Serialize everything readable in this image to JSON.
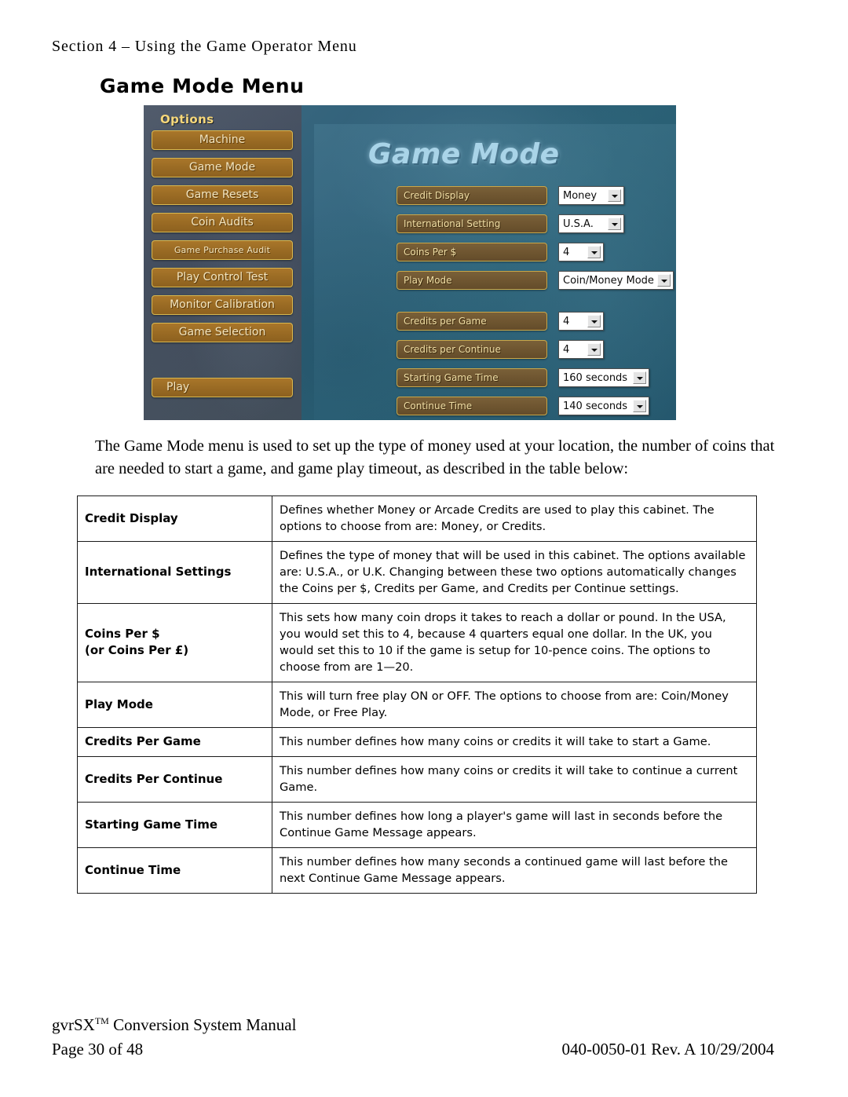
{
  "running_head": "Section 4  –  Using the Game Operator Menu",
  "page_title": "Game Mode Menu",
  "screenshot": {
    "heading": "Game Mode",
    "nav": {
      "title": "Options",
      "items": [
        "Machine",
        "Game Mode",
        "Game Resets",
        "Coin Audits",
        "Game Purchase Audit",
        "Play Control Test",
        "Monitor Calibration",
        "Game Selection"
      ],
      "play_label": "Play"
    },
    "settings": [
      {
        "label": "Credit Display",
        "value": "Money"
      },
      {
        "label": "International Setting",
        "value": "U.S.A."
      },
      {
        "label": "Coins Per $",
        "value": "4"
      },
      {
        "label": "Play Mode",
        "value": "Coin/Money Mode"
      },
      {
        "label": "Credits per Game",
        "value": "4"
      },
      {
        "label": "Credits per Continue",
        "value": "4"
      },
      {
        "label": "Starting Game Time",
        "value": "160 seconds"
      },
      {
        "label": "Continue Time",
        "value": "140 seconds"
      }
    ]
  },
  "intro_paragraph": "The Game Mode menu is used to set up the type of money used at your location, the number of coins that are needed to start a game, and game play timeout, as described in the table below:",
  "table": {
    "rows": [
      {
        "term": "Credit Display",
        "description": "Defines whether Money or Arcade Credits are used to play this cabinet. The options to choose from are: Money, or Credits."
      },
      {
        "term": "International Settings",
        "description": "Defines the type of money that will be used in this cabinet.  The options available are: U.S.A., or U.K.  Changing between these two options automatically changes the Coins per $, Credits per Game, and Credits per Continue settings."
      },
      {
        "term": "Coins Per $\n(or Coins Per £)",
        "description": "This sets how many coin drops it takes to reach a dollar or pound. In the USA, you would set this to 4, because 4 quarters equal one dollar. In the UK, you would set this to 10 if the game is setup for 10-pence coins. The options to choose from are 1—20."
      },
      {
        "term": "Play Mode",
        "description": "This will turn free play ON or OFF. The options to choose from are: Coin/Money Mode, or Free Play."
      },
      {
        "term": "Credits Per Game",
        "description": "This number defines how many coins or credits it will take to start a Game."
      },
      {
        "term": "Credits Per Continue",
        "description": "This number defines how many coins or credits it will take to continue a current Game."
      },
      {
        "term": "Starting Game Time",
        "description": "This number defines how long a player's game will last in seconds before the Continue Game Message appears."
      },
      {
        "term": "Continue Time",
        "description": "This number defines how many seconds a continued game will last before the next Continue Game Message appears."
      }
    ]
  },
  "footer": {
    "manual_title_prefix": "gvrSX",
    "manual_title_tm": "TM",
    "manual_title_suffix": " Conversion System Manual",
    "page_number": "Page 30 of 48",
    "doc_ref": "040-0050-01  Rev. A 10/29/2004"
  },
  "colors": {
    "nav_button_fill": "#9a6b24",
    "nav_button_border": "#d9b84e",
    "label_fill": "#6e5530",
    "label_text": "#f0dea5",
    "nav_title_text": "#f6d77a",
    "shot_heading": "#a9d4e8",
    "shot_bg": "#2f5f78",
    "nav_bg": "#3f4a5c"
  }
}
